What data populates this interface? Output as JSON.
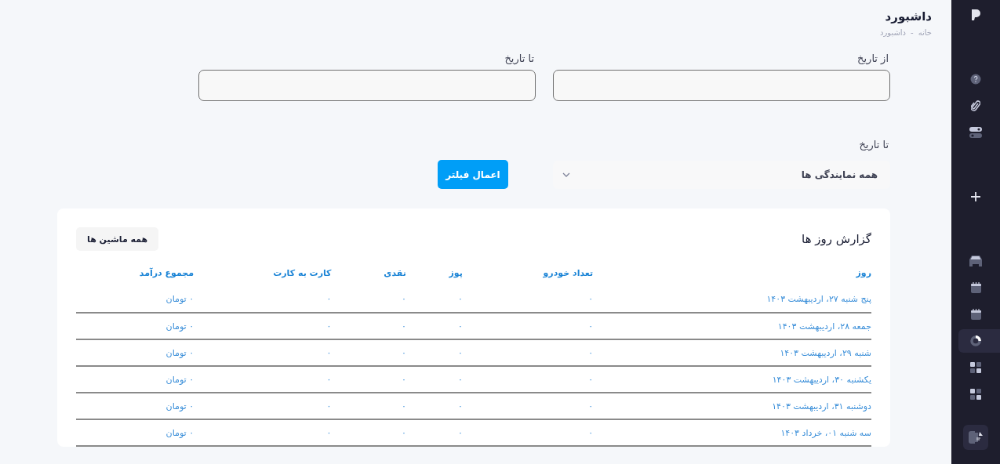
{
  "header": {
    "title": "داشبورد",
    "breadcrumb": [
      "خانه",
      "داشبورد"
    ],
    "separator": "-"
  },
  "filters": {
    "from_label": "از تاریخ",
    "to_label": "تا تاریخ",
    "agency_label": "تا تاریخ",
    "agency_value": "همه نمایندگی ها",
    "apply_button": "اعمال فیلتر"
  },
  "report": {
    "title": "گزارش روز ها",
    "machines_button": "همه ماشین ها",
    "columns": [
      "روز",
      "تعداد خودرو",
      "پوز",
      "نقدی",
      "کارت به کارت",
      "مجموع درآمد"
    ],
    "rows": [
      [
        "پنج شنبه ۲۷، اردیبهشت ۱۴۰۳",
        "۰",
        "۰",
        "۰",
        "۰",
        "۰ تومان"
      ],
      [
        "جمعه ۲۸، اردیبهشت ۱۴۰۳",
        "۰",
        "۰",
        "۰",
        "۰",
        "۰ تومان"
      ],
      [
        "شنبه ۲۹، اردیبهشت ۱۴۰۳",
        "۰",
        "۰",
        "۰",
        "۰",
        "۰ تومان"
      ],
      [
        "یکشنبه ۳۰، اردیبهشت ۱۴۰۳",
        "۰",
        "۰",
        "۰",
        "۰",
        "۰ تومان"
      ],
      [
        "دوشنبه ۳۱، اردیبهشت ۱۴۰۳",
        "۰",
        "۰",
        "۰",
        "۰",
        "۰ تومان"
      ],
      [
        "سه شنبه ۰۱، خرداد ۱۴۰۳",
        "۰",
        "۰",
        "۰",
        "۰",
        "۰ تومان"
      ]
    ]
  },
  "sidebar": {
    "items": [
      {
        "kind": "help",
        "selected": false
      },
      {
        "kind": "clip",
        "selected": false
      },
      {
        "kind": "toggle",
        "selected": false
      },
      {
        "kind": "plus",
        "selected": false
      },
      {
        "kind": "car",
        "selected": false
      },
      {
        "kind": "calendar",
        "selected": false
      },
      {
        "kind": "calendar",
        "selected": false
      },
      {
        "kind": "donut",
        "selected": true
      },
      {
        "kind": "grid",
        "selected": false
      },
      {
        "kind": "grid",
        "selected": false
      }
    ]
  }
}
